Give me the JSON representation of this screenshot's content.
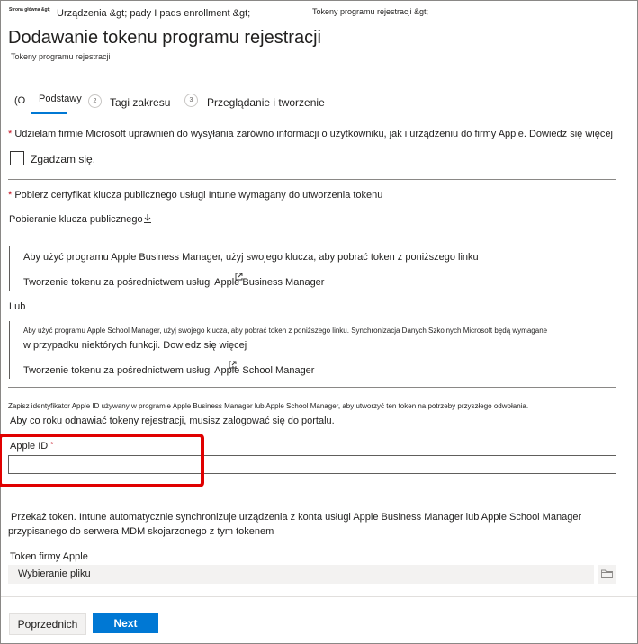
{
  "breadcrumb": {
    "home": "Strona główna &gt;",
    "section": "Urządzenia &gt; pady I pads enrollment &gt;",
    "current": "Tokeny programu rejestracji &gt;"
  },
  "page": {
    "title": "Dodawanie tokenu programu rejestracji",
    "subtitle": "Tokeny programu rejestracji"
  },
  "steps": [
    {
      "prefix": "(O",
      "label": "Podstawy"
    },
    {
      "number": "2",
      "label": "Tagi zakresu"
    },
    {
      "number": "3",
      "label": "Przeglądanie i tworzenie"
    }
  ],
  "consent": {
    "required_mark": "*",
    "text": "Udzielam firmie Microsoft uprawnień do wysyłania zarówno informacji o użytkowniku, jak i urządzeniu do firmy Apple. Dowiedz się więcej",
    "checkbox_label": "Zgadzam się."
  },
  "certificate": {
    "required_mark": "*",
    "text": "Pobierz certyfikat klucza publicznego usługi Intune wymagany do utworzenia tokenu",
    "download_link": "Pobieranie klucza publicznego"
  },
  "business_manager": {
    "info": "Aby użyć programu Apple Business Manager, użyj swojego klucza, aby pobrać token z poniższego linku",
    "link": "Tworzenie tokenu za pośrednictwem usługi Apple Business Manager"
  },
  "or_label": "Lub",
  "school_manager": {
    "info_line1": "Aby użyć programu Apple School Manager, użyj swojego klucza, aby pobrać token z poniższego linku. Synchronizacja Danych Szkolnych Microsoft będą wymagane",
    "info_line2": "w przypadku niektórych funkcji. Dowiedz się więcej",
    "link": "Tworzenie tokenu za pośrednictwem usługi Apple School Manager"
  },
  "apple_id_note": {
    "line1": "Zapisz identyfikator Apple ID używany w programie Apple Business Manager lub Apple School Manager, aby utworzyć ten token na potrzeby przyszłego odwołania.",
    "line2": "Aby co roku odnawiać tokeny rejestracji, musisz zalogować się do portalu."
  },
  "apple_id_field": {
    "label": "Apple ID",
    "required_mark": "*",
    "value": ""
  },
  "upload": {
    "text_line1": "Przekaż token. Intune automatycznie synchronizuje urządzenia z konta usługi Apple Business Manager lub Apple School Manager",
    "text_line2": "przypisanego do serwera MDM skojarzonego z tym tokenem",
    "field_label": "Token firmy Apple",
    "placeholder": "Wybieranie pliku"
  },
  "footer": {
    "previous": "Poprzednich",
    "next": "Next"
  },
  "colors": {
    "primary": "#0078d4",
    "required": "#c50f1f",
    "highlight": "#e00000"
  }
}
